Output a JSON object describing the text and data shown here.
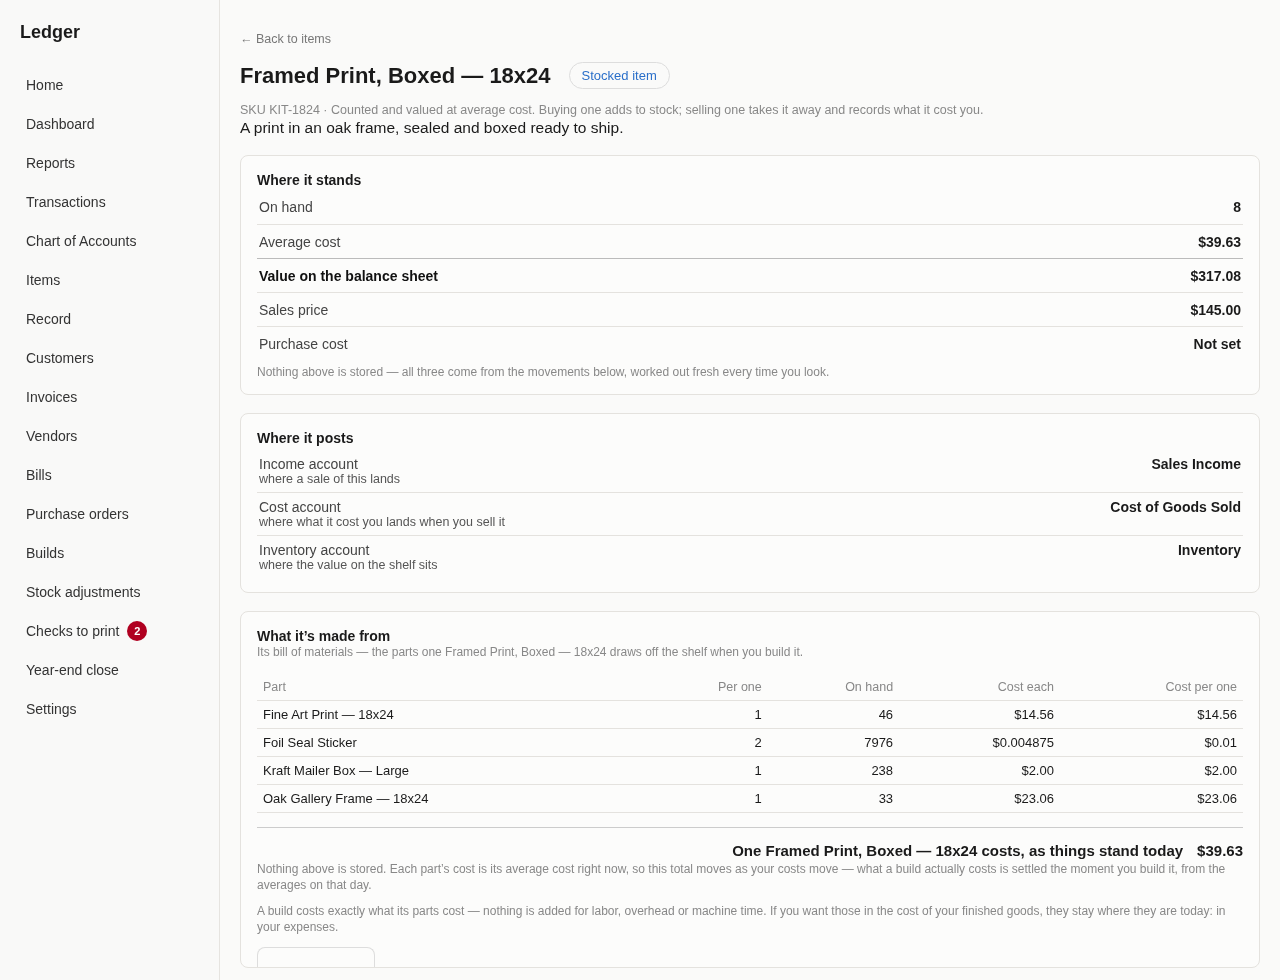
{
  "sidebar": {
    "brand": "Ledger",
    "items": [
      {
        "label": "Home"
      },
      {
        "label": "Dashboard"
      },
      {
        "label": "Reports"
      },
      {
        "label": "Transactions"
      },
      {
        "label": "Chart of Accounts"
      },
      {
        "label": "Items"
      },
      {
        "label": "Record"
      },
      {
        "label": "Customers"
      },
      {
        "label": "Invoices"
      },
      {
        "label": "Vendors"
      },
      {
        "label": "Bills"
      },
      {
        "label": "Purchase orders"
      },
      {
        "label": "Builds"
      },
      {
        "label": "Stock adjustments"
      },
      {
        "label": "Checks to print",
        "badge": "2"
      },
      {
        "label": "Year-end close"
      },
      {
        "label": "Settings"
      }
    ]
  },
  "back_link": "← Back to items",
  "title": "Framed Print, Boxed — 18x24",
  "tag": "Stocked item",
  "meta": "SKU KIT-1824 · Counted and valued at average cost. Buying one adds to stock; selling one takes it away and records what it cost you.",
  "description": "A print in an oak frame, sealed and boxed ready to ship.",
  "standing": {
    "title": "Where it stands",
    "rows": [
      {
        "kind": "plain",
        "label": "On hand",
        "value": "8"
      },
      {
        "kind": "plain",
        "label": "Average cost",
        "value": "$39.63"
      },
      {
        "kind": "total",
        "label": "Value on the balance sheet",
        "value": "$317.08"
      },
      {
        "kind": "plain",
        "label": "Sales price",
        "value": "$145.00"
      },
      {
        "kind": "plain",
        "label": "Purchase cost",
        "value": "Not set"
      }
    ],
    "note": "Nothing above is stored — all three come from the movements below, worked out fresh every time you look."
  },
  "posting": {
    "title": "Where it posts",
    "rows": [
      {
        "label": "Income account",
        "hint": "where a sale of this lands",
        "value": "Sales Income"
      },
      {
        "label": "Cost account",
        "hint": "where what it cost you lands when you sell it",
        "value": "Cost of Goods Sold"
      },
      {
        "label": "Inventory account",
        "hint": "where the value on the shelf sits",
        "value": "Inventory"
      }
    ]
  },
  "bom": {
    "title": "What it’s made from",
    "subtitle": "Its bill of materials — the parts one Framed Print, Boxed — 18x24 draws off the shelf when you build it.",
    "columns": [
      "Part",
      "Per one",
      "On hand",
      "Cost each",
      "Cost per one"
    ],
    "rows": [
      [
        "Fine Art Print — 18x24",
        "1",
        "46",
        "$14.56",
        "$14.56"
      ],
      [
        "Foil Seal Sticker",
        "2",
        "7976",
        "$0.004875",
        "$0.01"
      ],
      [
        "Kraft Mailer Box — Large",
        "1",
        "238",
        "$2.00",
        "$2.00"
      ],
      [
        "Oak Gallery Frame — 18x24",
        "1",
        "33",
        "$23.06",
        "$23.06"
      ]
    ],
    "total_label": "One Framed Print, Boxed — 18x24 costs, as things stand today",
    "total_value": "$39.63",
    "notes": [
      "Nothing above is stored. Each part’s cost is its average cost right now, so this total moves as your costs move — what a build actually costs is settled the moment you build it, from the averages on that day.",
      "A build costs exactly what its parts cost — nothing is added for labor, overhead or machine time. If you want those in the cost of your finished goods, they stay where they are today: in your expenses."
    ]
  }
}
